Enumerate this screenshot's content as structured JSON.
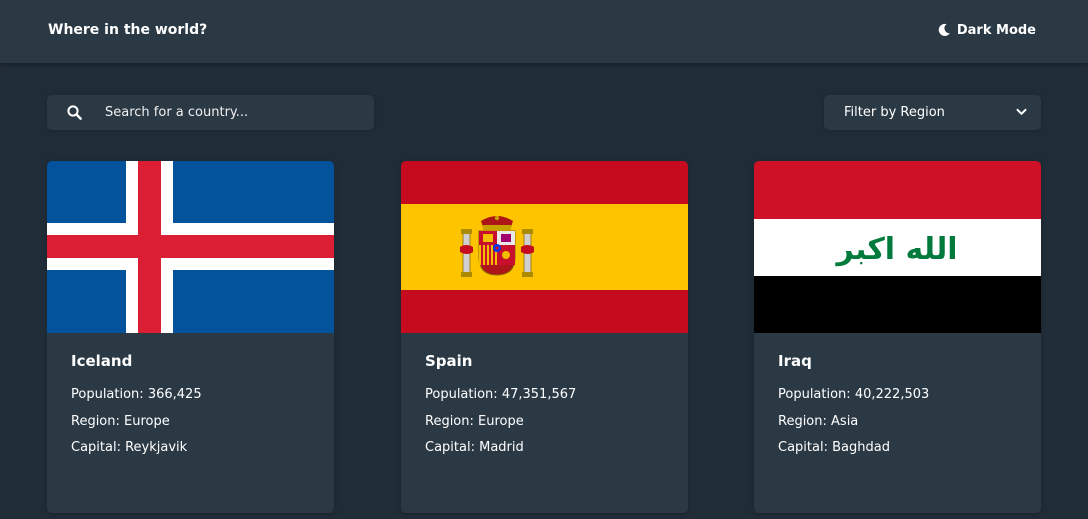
{
  "header": {
    "title": "Where in the world?",
    "mode_label": "Dark Mode",
    "mode_icon": "moon-icon"
  },
  "search": {
    "placeholder": "Search for a country...",
    "value": "",
    "icon": "search-icon"
  },
  "filter": {
    "label": "Filter by Region",
    "icon": "chevron-down-icon"
  },
  "labels": {
    "population": "Population:",
    "region": "Region:",
    "capital": "Capital:"
  },
  "countries": [
    {
      "name": "Iceland",
      "population": "366,425",
      "region": "Europe",
      "capital": "Reykjavik"
    },
    {
      "name": "Spain",
      "population": "47,351,567",
      "region": "Europe",
      "capital": "Madrid"
    },
    {
      "name": "Iraq",
      "population": "40,222,503",
      "region": "Asia",
      "capital": "Baghdad"
    }
  ],
  "iraq_flag_text": "الله اكبر",
  "colors": {
    "background": "#202c37",
    "elements": "#2b3945",
    "text": "#ffffff"
  }
}
